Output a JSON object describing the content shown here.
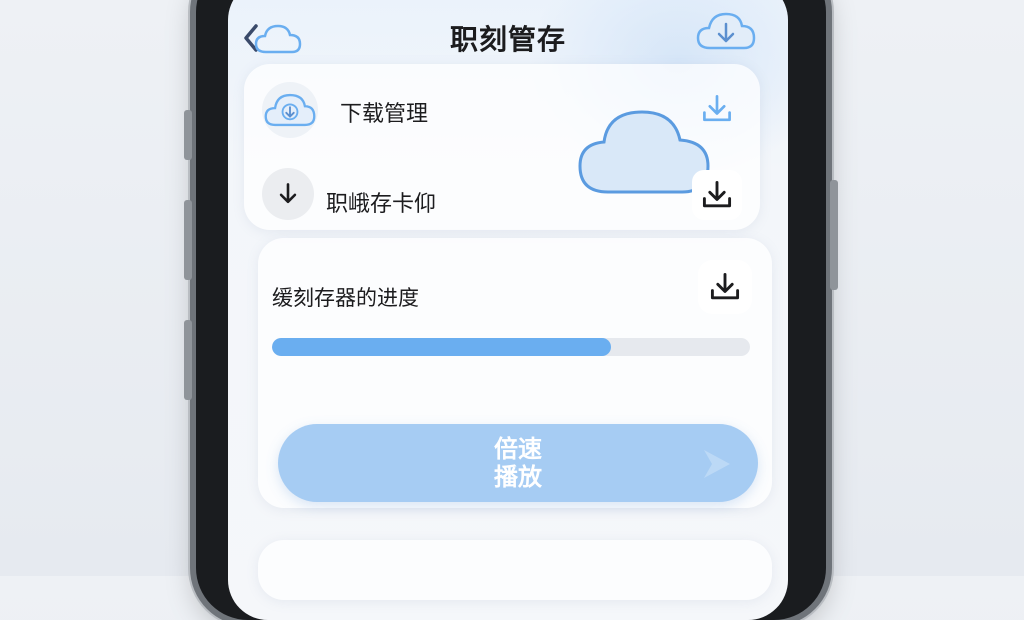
{
  "header": {
    "title": "职刻管存"
  },
  "download_card": {
    "rows": [
      {
        "label": "下载管理",
        "icon": "cloud-download-icon",
        "action_icon": "download-icon"
      },
      {
        "label": "职峨存卡仰",
        "icon": "arrow-down-icon",
        "action_icon": "download-icon"
      }
    ]
  },
  "progress_card": {
    "label": "缓刻存器的进度",
    "progress_fraction": 0.71,
    "action_icon": "download-icon"
  },
  "speed_button": {
    "label": "倍速\n播放",
    "icon": "chevron-right-icon"
  },
  "colors": {
    "accent": "#6aaef0",
    "button": "#a6ccf3",
    "icon_outline": "#5b8fcf"
  }
}
